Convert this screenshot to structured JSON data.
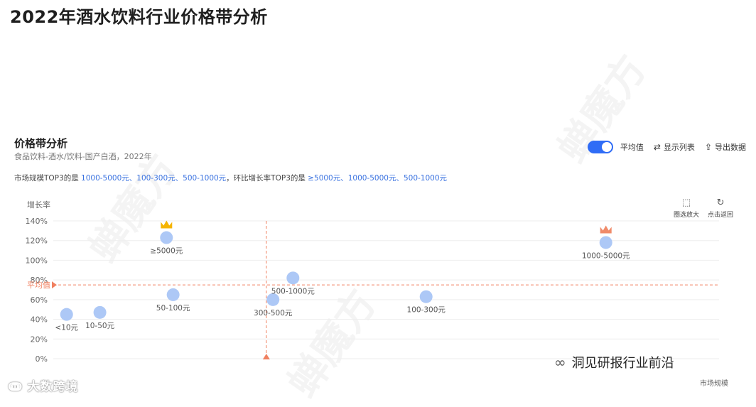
{
  "page_title": "2022年酒水饮料行业价格带分析",
  "panel": {
    "title": "价格带分析",
    "subtitle": "食品饮料-酒水/饮料-国产白酒，2022年",
    "toggle_label": "平均值",
    "toggle_on": true,
    "show_list_label": "显示列表",
    "export_label": "导出数据"
  },
  "summary": {
    "prefix": "市场规模TOP3的是 ",
    "top3_scale": "1000-5000元、100-300元、500-1000元",
    "middle": "，环比增长率TOP3的是 ",
    "top3_growth": "≥5000元、1000-5000元、500-1000元"
  },
  "zoom_tools": {
    "select_zoom": "圈选放大",
    "reset": "点击返回"
  },
  "chart_data": {
    "type": "scatter",
    "ylabel": "增长率",
    "xlabel": "市场规模",
    "yticks": [
      "0%",
      "20%",
      "40%",
      "60%",
      "80%",
      "100%",
      "120%",
      "140%"
    ],
    "ylim": [
      0,
      140
    ],
    "average_label": "平均值",
    "average_y": 75,
    "points": [
      {
        "label": "<10元",
        "x": 0.02,
        "y": 45
      },
      {
        "label": "10-50元",
        "x": 0.07,
        "y": 47
      },
      {
        "label": "≥5000元",
        "x": 0.17,
        "y": 123,
        "crown": "gold"
      },
      {
        "label": "50-100元",
        "x": 0.18,
        "y": 65
      },
      {
        "label": "300-500元",
        "x": 0.33,
        "y": 60
      },
      {
        "label": "500-1000元",
        "x": 0.36,
        "y": 82
      },
      {
        "label": "100-300元",
        "x": 0.56,
        "y": 63
      },
      {
        "label": "1000-5000元",
        "x": 0.83,
        "y": 118,
        "crown": "orange"
      }
    ],
    "average_x": 0.32,
    "colors": {
      "point": "#a9c5f5",
      "average": "#f08060",
      "grid": "#eeeeee"
    }
  },
  "footer": {
    "brand": "大数跨境",
    "wechat_label": "洞见研报行业前沿"
  },
  "watermark": "蝉魔方"
}
